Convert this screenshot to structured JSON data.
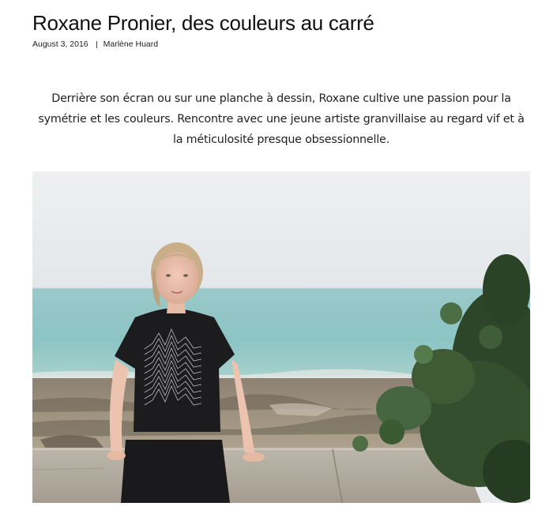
{
  "article": {
    "title": "Roxane Pronier, des couleurs au carré",
    "date": "August 3, 2016",
    "author": "Marlène Huard",
    "lede": "Derrière son écran ou sur une planche à dessin, Roxane cultive une passion pour la symétrie et les couleurs. Rencontre avec une jeune artiste granvillaise au regard vif et à la méticulosité presque obsessionnelle."
  },
  "photo": {
    "subject": "woman-sitting-on-stone-wall-by-sea",
    "colors": {
      "sky": "#e8ebed",
      "sea": "#8fc3c4",
      "sand": "#a49683",
      "wall": "#b1aa9e",
      "shirt": "#1c1c1e",
      "foliage": "#2f4a2c"
    }
  }
}
